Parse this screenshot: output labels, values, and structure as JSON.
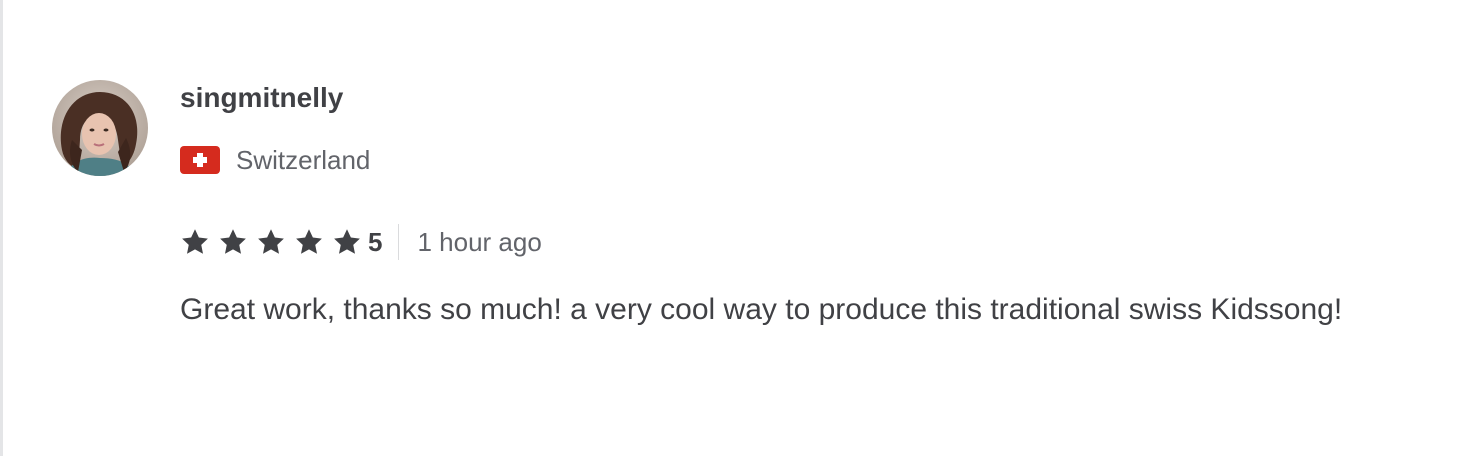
{
  "review": {
    "username": "singmitnelly",
    "country": "Switzerland",
    "country_flag_icon": "switzerland-flag-icon",
    "rating": "5",
    "rating_stars": 5,
    "time_ago": "1 hour ago",
    "text": "Great work, thanks so much! a very cool way to produce this traditional swiss Kidssong!"
  },
  "colors": {
    "text_primary": "#404145",
    "text_secondary": "#62646a",
    "star": "#404145",
    "flag_red": "#d52b1e",
    "divider": "#dadbdd"
  }
}
